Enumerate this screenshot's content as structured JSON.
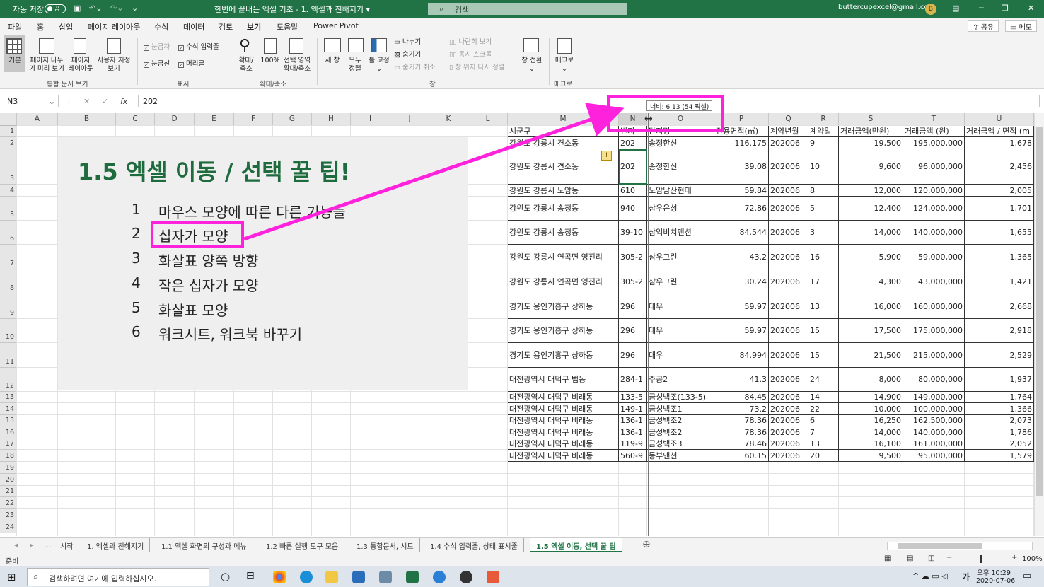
{
  "titlebar": {
    "autosave": "자동 저장",
    "autosave_state": "끔",
    "doc_title": "한번에 끝내는 엑셀 기초 - 1. 엑셀과 친해지기 ▾",
    "search": "검색",
    "account": "buttercupexcel@gmail.com",
    "avatar_letter": "B",
    "min": "─",
    "restore": "❐",
    "close": "✕"
  },
  "menu": {
    "items": [
      "파일",
      "홈",
      "삽입",
      "페이지 레이아웃",
      "수식",
      "데이터",
      "검토",
      "보기",
      "도움말",
      "Power Pivot"
    ],
    "active_index": 7,
    "share": "공유",
    "comments": "메모"
  },
  "ribbon": {
    "workbook_views": {
      "group": "통합 문서 보기",
      "normal": "기본",
      "page_break_1": "페이지 나누",
      "page_break_2": "기 미리 보기",
      "page_layout_1": "페이지",
      "page_layout_2": "레이아웃",
      "custom_1": "사용자 지정",
      "custom_2": "보기"
    },
    "show": {
      "group": "표시",
      "ruler": "눈금자",
      "formula_bar": "수식 입력줄",
      "gridlines": "눈금선",
      "headings": "머리글"
    },
    "zoom": {
      "group": "확대/축소",
      "zoom_1": "확대/",
      "zoom_2": "축소",
      "p100": "100%",
      "sel_1": "선택 영역",
      "sel_2": "확대/축소"
    },
    "window": {
      "group": "창",
      "new_window": "새 창",
      "arrange_1": "모두",
      "arrange_2": "정렬",
      "freeze": "틀 고정",
      "split": "나누기",
      "hide": "숨기기",
      "unhide": "숨기기 취소",
      "side_by_side": "나란히 보기",
      "sync_scroll": "동시 스크롤",
      "reset_pos": "창 위치 다시 정렬",
      "switch_1": "창 전환"
    },
    "macros": {
      "group": "매크로",
      "macros": "매크로"
    }
  },
  "formula": {
    "namebox": "N3",
    "cancel": "✕",
    "enter": "✓",
    "fx": "fx",
    "value": "202"
  },
  "tooltip": "너비: 6.13 (54 픽셀)",
  "columns": [
    "A",
    "B",
    "C",
    "D",
    "E",
    "F",
    "G",
    "H",
    "I",
    "J",
    "K",
    "L",
    "M",
    "N",
    "O",
    "P",
    "Q",
    "R",
    "S",
    "T",
    "U"
  ],
  "rows": [
    "1",
    "2",
    "3",
    "4",
    "5",
    "6",
    "7",
    "8",
    "9",
    "10",
    "11",
    "12",
    "13",
    "14",
    "15",
    "16",
    "17",
    "18",
    "19",
    "20",
    "21",
    "22",
    "23",
    "24"
  ],
  "slide": {
    "title": "1.5 엑셀 이동 / 선택 꿀 팁!",
    "items": [
      {
        "n": "1",
        "t": "마우스 모양에 따른 다른 기능들"
      },
      {
        "n": "2",
        "t": "십자가 모양"
      },
      {
        "n": "3",
        "t": "화살표 양쪽 방향"
      },
      {
        "n": "4",
        "t": "작은 십자가 모양"
      },
      {
        "n": "5",
        "t": "화살표 모양"
      },
      {
        "n": "6",
        "t": "워크시트, 워크북 바꾸기"
      }
    ]
  },
  "table": {
    "headers": [
      "시군구",
      "번지",
      "단지명",
      "전용면적(㎡)",
      "계약년월",
      "계약일",
      "거래금액(만원)",
      "거래금액 (원)",
      "거래금액 / 면적 (m"
    ],
    "rows": [
      [
        "강원도 강릉시 견소동",
        "202",
        "송정한신",
        "116.175",
        "202006",
        "9",
        "19,500",
        "195,000,000",
        "1,678"
      ],
      [
        "강원도 강릉시 견소동",
        "202",
        "송정한신",
        "39.08",
        "202006",
        "10",
        "9,600",
        "96,000,000",
        "2,456"
      ],
      [
        "강원도 강릉시 노암동",
        "610",
        "노암남산현대",
        "59.84",
        "202006",
        "8",
        "12,000",
        "120,000,000",
        "2,005"
      ],
      [
        "강원도 강릉시 송정동",
        "940",
        "삼우은성",
        "72.86",
        "202006",
        "5",
        "12,400",
        "124,000,000",
        "1,701"
      ],
      [
        "강원도 강릉시 송정동",
        "39-10",
        "삼익비치맨션",
        "84.544",
        "202006",
        "3",
        "14,000",
        "140,000,000",
        "1,655"
      ],
      [
        "강원도 강릉시 연곡면 영진리",
        "305-2",
        "삼우그린",
        "43.2",
        "202006",
        "16",
        "5,900",
        "59,000,000",
        "1,365"
      ],
      [
        "강원도 강릉시 연곡면 영진리",
        "305-2",
        "삼우그린",
        "30.24",
        "202006",
        "17",
        "4,300",
        "43,000,000",
        "1,421"
      ],
      [
        "경기도 용인기흥구 상하동",
        "296",
        "대우",
        "59.97",
        "202006",
        "13",
        "16,000",
        "160,000,000",
        "2,668"
      ],
      [
        "경기도 용인기흥구 상하동",
        "296",
        "대우",
        "59.97",
        "202006",
        "15",
        "17,500",
        "175,000,000",
        "2,918"
      ],
      [
        "경기도 용인기흥구 상하동",
        "296",
        "대우",
        "84.994",
        "202006",
        "15",
        "21,500",
        "215,000,000",
        "2,529"
      ],
      [
        "대전광역시 대덕구 법동",
        "284-1",
        "주공2",
        "41.3",
        "202006",
        "24",
        "8,000",
        "80,000,000",
        "1,937"
      ],
      [
        "대전광역시 대덕구 비래동",
        "133-5",
        "금성백조(133-5)",
        "84.45",
        "202006",
        "14",
        "14,900",
        "149,000,000",
        "1,764"
      ],
      [
        "대전광역시 대덕구 비래동",
        "149-1",
        "금성백조1",
        "73.2",
        "202006",
        "22",
        "10,000",
        "100,000,000",
        "1,366"
      ],
      [
        "대전광역시 대덕구 비래동",
        "136-1",
        "금성백조2",
        "78.36",
        "202006",
        "6",
        "16,250",
        "162,500,000",
        "2,073"
      ],
      [
        "대전광역시 대덕구 비래동",
        "136-1",
        "금성백조2",
        "78.36",
        "202006",
        "7",
        "14,000",
        "140,000,000",
        "1,786"
      ],
      [
        "대전광역시 대덕구 비래동",
        "119-9",
        "금성백조3",
        "78.46",
        "202006",
        "13",
        "16,100",
        "161,000,000",
        "2,052"
      ],
      [
        "대전광역시 대덕구 비래동",
        "560-9",
        "동부맨션",
        "60.15",
        "202006",
        "20",
        "9,500",
        "95,000,000",
        "1,579"
      ]
    ]
  },
  "sheets": {
    "tabs": [
      "시작",
      "1. 엑셀과 친해지기",
      "1.1 엑셀 화면의 구성과 메뉴",
      "1.2 빠른 실행 도구 모음",
      "1.3 통합문서, 시트",
      "1.4 수식 입력줄, 상태 표시줄",
      "1.5 엑셀 이동, 선택 꿀 팁"
    ],
    "active_index": 6,
    "add": "⊕"
  },
  "status": {
    "ready": "준비",
    "zoom": "100%",
    "minus": "−",
    "plus": "+"
  },
  "taskbar": {
    "search_placeholder": "검색하려면 여기에 입력하십시오.",
    "time": "오후 10:29",
    "date": "2020-07-06",
    "ime": "가"
  },
  "colors": {
    "excel_green": "#217346",
    "highlight": "#ff22dd",
    "slide_bg": "#efefef",
    "slide_title": "#1e6b3d"
  }
}
